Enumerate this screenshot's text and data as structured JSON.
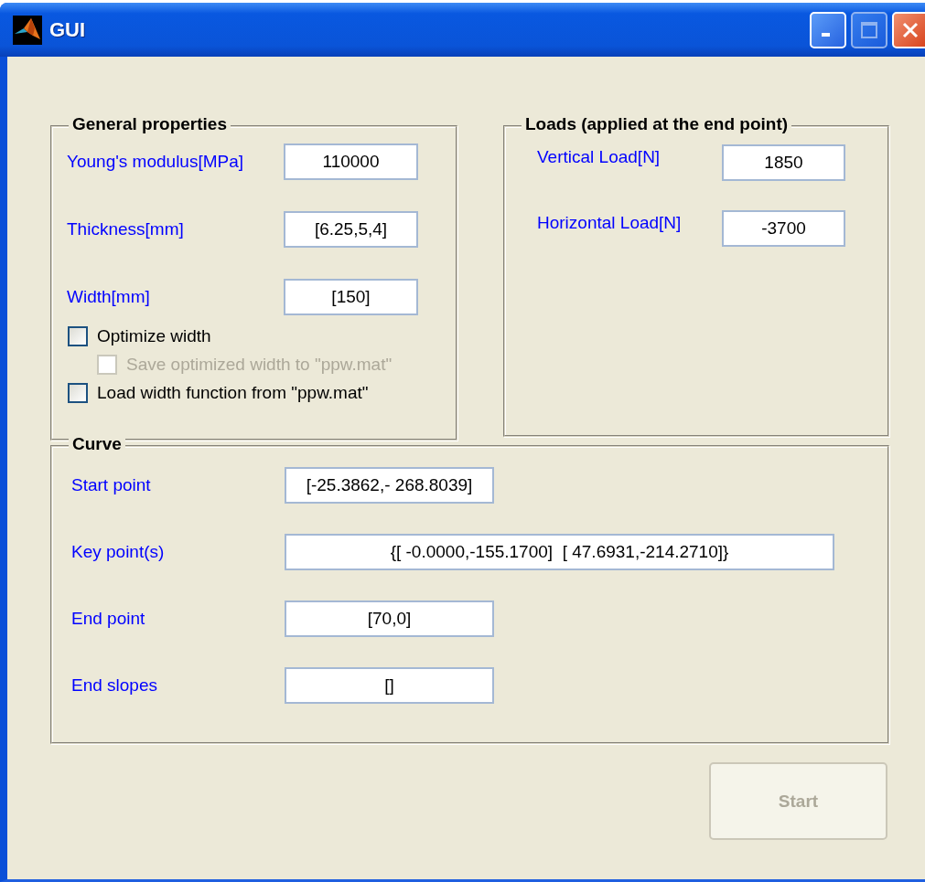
{
  "window": {
    "title": "GUI"
  },
  "general": {
    "title": "General properties",
    "fields": [
      {
        "label": "Young's modulus[MPa]",
        "value": "110000"
      },
      {
        "label": "Thickness[mm]",
        "value": "[6.25,5,4]"
      },
      {
        "label": "Width[mm]",
        "value": "[150]"
      }
    ],
    "checkboxes": [
      {
        "label": "Optimize width",
        "checked": false,
        "disabled": false,
        "children": [
          {
            "label": "Save optimized width to \"ppw.mat\"",
            "checked": false,
            "disabled": true
          }
        ]
      },
      {
        "label": "Load width function from \"ppw.mat\"",
        "checked": false,
        "disabled": false
      }
    ]
  },
  "loads": {
    "title": "Loads (applied at the end point)",
    "fields": [
      {
        "label": "Vertical Load[N]",
        "value": "1850"
      },
      {
        "label": "Horizontal Load[N]",
        "value": "-3700"
      }
    ]
  },
  "curve": {
    "title": "Curve",
    "fields": [
      {
        "label": "Start point",
        "value": "[-25.3862,- 268.8039]",
        "kind": "short"
      },
      {
        "label": "Key point(s)",
        "value": "{[ -0.0000,-155.1700]  [ 47.6931,-214.2710]}",
        "kind": "wide"
      },
      {
        "label": "End point",
        "value": "[70,0]",
        "kind": "short"
      },
      {
        "label": "End slopes",
        "value": "[]",
        "kind": "short"
      }
    ]
  },
  "start_button": {
    "label": "Start",
    "disabled": true
  }
}
